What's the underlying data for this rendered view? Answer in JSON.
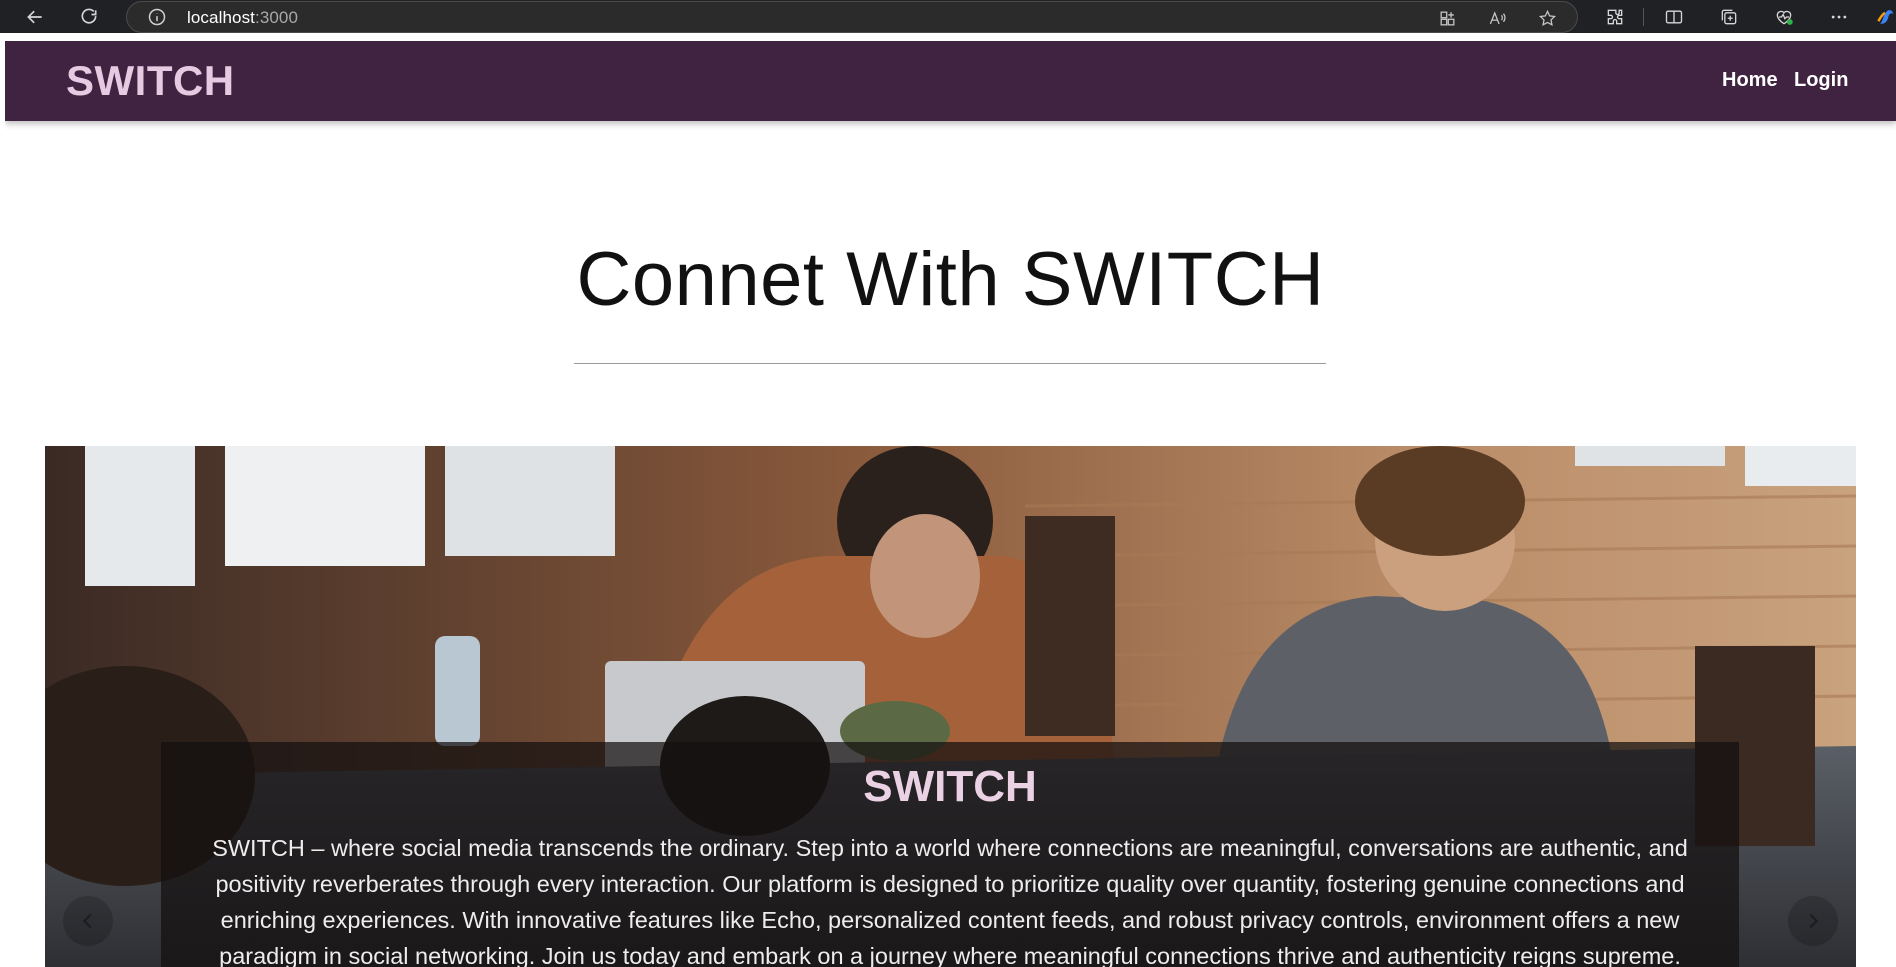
{
  "browser": {
    "url_host": "localhost",
    "url_port": ":3000",
    "icons": [
      "back-icon",
      "refresh-icon",
      "site-info-icon",
      "app-available-icon",
      "read-aloud-icon",
      "favorite-star-icon",
      "extensions-icon",
      "split-screen-icon",
      "collections-icon",
      "browser-health-icon",
      "more-menu-icon",
      "copilot-icon"
    ]
  },
  "navbar": {
    "brand": "SWITCH",
    "links": [
      "Home",
      "Login"
    ],
    "background": "#3f2340",
    "brand_color": "#e8c9e2"
  },
  "hero": {
    "title": "Connet With SWITCH"
  },
  "carousel": {
    "caption_title": "SWITCH",
    "caption_text": "SWITCH – where social media transcends the ordinary. Step into a world where connections are meaningful, conversations are authentic, and positivity reverberates through every interaction. Our platform is designed to prioritize quality over quantity, fostering genuine connections and enriching experiences. With innovative features like Echo, personalized content feeds, and robust privacy controls, environment offers a new paradigm in social networking. Join us today and embark on a journey where meaningful connections thrive and authenticity reigns supreme.",
    "prev_icon": "chevron-left-icon",
    "next_icon": "chevron-right-icon"
  }
}
